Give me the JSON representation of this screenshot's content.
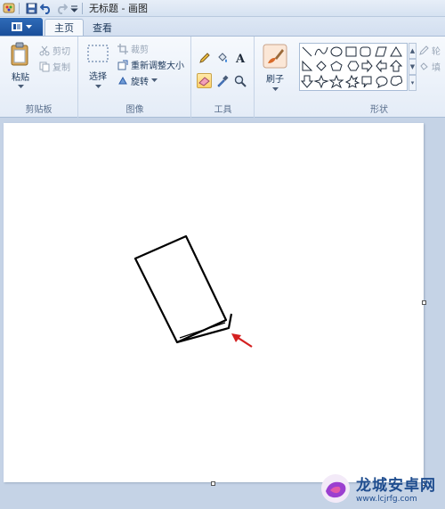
{
  "titlebar": {
    "title": "无标题 - 画图"
  },
  "tabs": {
    "home": "主页",
    "view": "查看"
  },
  "clipboard": {
    "paste": "粘贴",
    "cut": "剪切",
    "copy": "复制",
    "group": "剪贴板"
  },
  "image": {
    "select": "选择",
    "crop": "裁剪",
    "resize": "重新调整大小",
    "rotate": "旋转",
    "group": "图像"
  },
  "tools": {
    "group": "工具"
  },
  "brushes": {
    "label": "刷子"
  },
  "shapes": {
    "group": "形状",
    "outline": "轮",
    "fill": "填"
  },
  "watermark": {
    "title": "龙城安卓网",
    "url": "www.lcjrfg.com"
  },
  "colors": {
    "file_button": "#1a4f9a",
    "selected_tool": "#ffd26a",
    "arrow": "#d42020"
  }
}
